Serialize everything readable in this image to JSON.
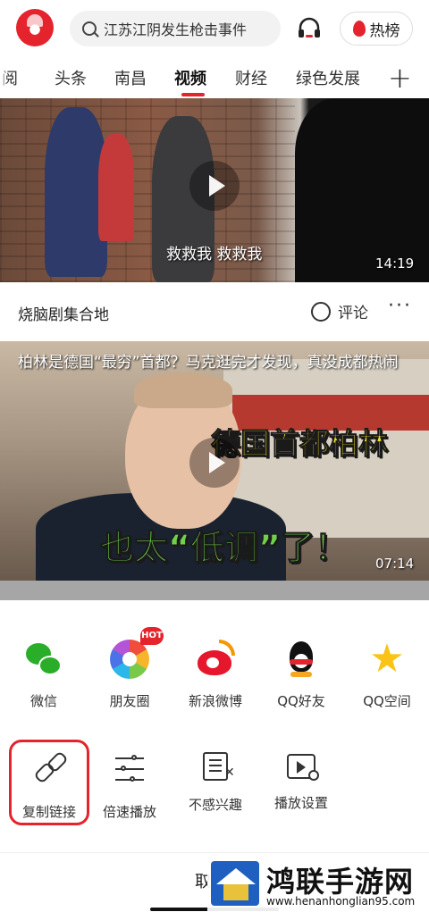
{
  "header": {
    "search_text": "江苏江阴发生枪击事件",
    "hot_label": "热榜"
  },
  "tabs": [
    {
      "label": "阅",
      "active": false
    },
    {
      "label": "头条",
      "active": false
    },
    {
      "label": "南昌",
      "active": false
    },
    {
      "label": "视频",
      "active": true
    },
    {
      "label": "财经",
      "active": false
    },
    {
      "label": "绿色发展",
      "active": false
    }
  ],
  "feed": [
    {
      "subtitle": "救救我 救救我",
      "duration": "14:19",
      "source": "烧脑剧集合地",
      "comment_label": "评论",
      "more": "···"
    },
    {
      "title": "柏林是德国“最穷”首都？马克逛完才发现，真没成都热闹",
      "caption_top": "德国首都柏林",
      "caption_bottom": "也太“低调”了！",
      "duration": "07:14"
    }
  ],
  "share_sheet": {
    "share_targets": [
      {
        "label": "微信",
        "icon": "wechat-icon"
      },
      {
        "label": "朋友圈",
        "icon": "moments-icon",
        "badge": "HOT"
      },
      {
        "label": "新浪微博",
        "icon": "weibo-icon"
      },
      {
        "label": "QQ好友",
        "icon": "qq-icon"
      },
      {
        "label": "QQ空间",
        "icon": "qzone-icon"
      }
    ],
    "actions": [
      {
        "label": "复制链接",
        "icon": "link-icon",
        "highlighted": true
      },
      {
        "label": "倍速播放",
        "icon": "speed-icon"
      },
      {
        "label": "不感兴趣",
        "icon": "dislike-icon"
      },
      {
        "label": "播放设置",
        "icon": "play-settings-icon"
      }
    ],
    "cancel_label": "取"
  },
  "watermark": {
    "title": "鸿联手游网",
    "url": "www.henanhonglian95.com"
  },
  "colors": {
    "accent": "#e5232d",
    "highlight_border": "#e5232d"
  }
}
